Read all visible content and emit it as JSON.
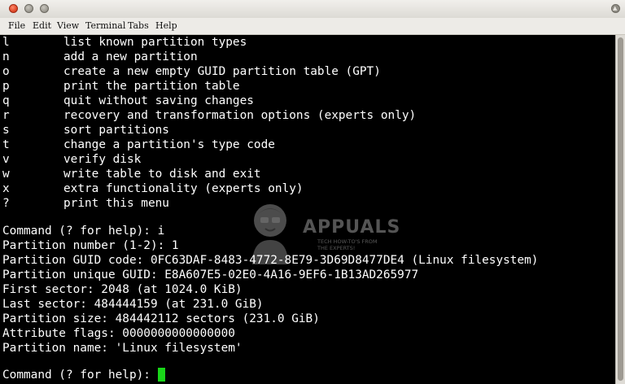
{
  "menu": {
    "items": [
      "File",
      "Edit",
      "View",
      "Terminal",
      "Tabs",
      "Help"
    ]
  },
  "commands": [
    {
      "key": "l",
      "desc": "list known partition types"
    },
    {
      "key": "n",
      "desc": "add a new partition"
    },
    {
      "key": "o",
      "desc": "create a new empty GUID partition table (GPT)"
    },
    {
      "key": "p",
      "desc": "print the partition table"
    },
    {
      "key": "q",
      "desc": "quit without saving changes"
    },
    {
      "key": "r",
      "desc": "recovery and transformation options (experts only)"
    },
    {
      "key": "s",
      "desc": "sort partitions"
    },
    {
      "key": "t",
      "desc": "change a partition's type code"
    },
    {
      "key": "v",
      "desc": "verify disk"
    },
    {
      "key": "w",
      "desc": "write table to disk and exit"
    },
    {
      "key": "x",
      "desc": "extra functionality (experts only)"
    },
    {
      "key": "?",
      "desc": "print this menu"
    }
  ],
  "output": [
    "Command (? for help): i",
    "Partition number (1-2): 1",
    "Partition GUID code: 0FC63DAF-8483-4772-8E79-3D69D8477DE4 (Linux filesystem)",
    "Partition unique GUID: E8A607E5-02E0-4A16-9EF6-1B13AD265977",
    "First sector: 2048 (at 1024.0 KiB)",
    "Last sector: 484444159 (at 231.0 GiB)",
    "Partition size: 484442112 sectors (231.0 GiB)",
    "Attribute flags: 0000000000000000",
    "Partition name: 'Linux filesystem'"
  ],
  "prompt": "Command (? for help):",
  "watermark": {
    "name": "APPUALS",
    "tagline": "TECH HOW-TO'S FROM THE EXPERTS!"
  },
  "colors": {
    "terminal_bg": "#000000",
    "terminal_fg": "#ffffff",
    "cursor": "#19d619",
    "close_button": "#e0492a"
  }
}
